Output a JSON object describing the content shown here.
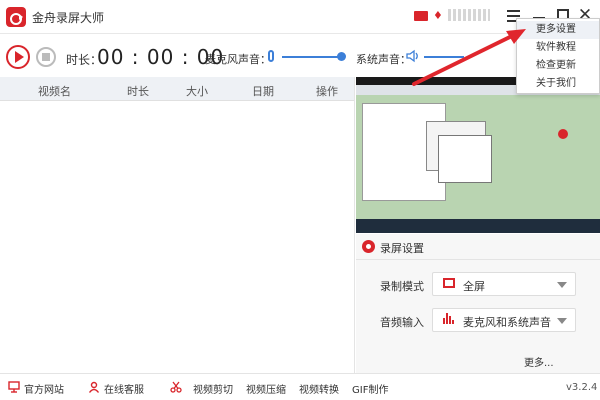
{
  "app": {
    "title": "金舟录屏大师"
  },
  "titlebar": {
    "icons": [
      "mail-icon",
      "gem-icon",
      "menu-icon",
      "minimize-icon",
      "maximize-icon",
      "close-icon"
    ],
    "close_glyph": "✕"
  },
  "menu": {
    "items": [
      {
        "label": "更多设置"
      },
      {
        "label": "软件教程"
      },
      {
        "label": "检查更新"
      },
      {
        "label": "关于我们"
      }
    ]
  },
  "toolbar": {
    "duration_label": "时长：",
    "timer": "00 : 00 : 00",
    "mic_label": "麦克风声音：",
    "system_label": "系统声音："
  },
  "table": {
    "columns": [
      "视频名",
      "时长",
      "大小",
      "日期",
      "操作"
    ]
  },
  "settings": {
    "title": "录屏设置",
    "mode_label": "录制模式",
    "mode_value": "全屏",
    "audio_label": "音频输入",
    "audio_value": "麦克风和系统声音",
    "more_label": "更多..."
  },
  "footer": {
    "items": [
      {
        "label": "官方网站",
        "icon": "monitor-icon"
      },
      {
        "label": "在线客服",
        "icon": "person-icon"
      },
      {
        "label": "视频剪切",
        "icon": "scissors-icon"
      },
      {
        "label": "视频压缩"
      },
      {
        "label": "视频转换"
      },
      {
        "label": "GIF制作"
      }
    ],
    "version": "v3.2.4"
  },
  "colors": {
    "accent": "#d9252b",
    "slider": "#3c7fd8",
    "header_bg": "#eef1f5"
  }
}
